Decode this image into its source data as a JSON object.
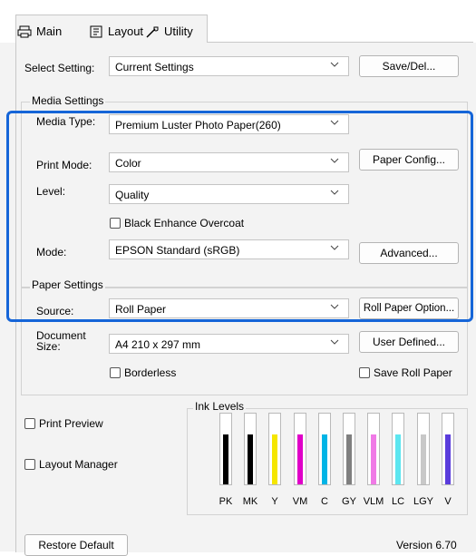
{
  "tabs": [
    {
      "label": "Main",
      "icon": "printer-icon"
    },
    {
      "label": "Layout",
      "icon": "layout-icon"
    },
    {
      "label": "Utility",
      "icon": "wrench-icon"
    }
  ],
  "select_setting": {
    "label": "Select Setting:",
    "value": "Current Settings",
    "button": "Save/Del..."
  },
  "media_settings": {
    "title": "Media Settings",
    "media_type": {
      "label": "Media Type:",
      "value": "Premium Luster Photo Paper(260)"
    },
    "print_mode": {
      "label": "Print Mode:",
      "value": "Color",
      "button": "Paper Config..."
    },
    "level": {
      "label": "Level:",
      "value": "Quality"
    },
    "black_enhance": {
      "label": "Black Enhance Overcoat",
      "checked": false
    },
    "mode": {
      "label": "Mode:",
      "value": "EPSON Standard (sRGB)",
      "button": "Advanced..."
    }
  },
  "paper_settings": {
    "title": "Paper Settings",
    "source": {
      "label": "Source:",
      "value": "Roll Paper",
      "button": "Roll Paper Option..."
    },
    "document_size": {
      "label_line1": "Document",
      "label_line2": "Size:",
      "value": "A4 210 x 297 mm",
      "button": "User Defined..."
    },
    "borderless": {
      "label": "Borderless",
      "checked": false
    },
    "save_roll_paper": {
      "label": "Save Roll Paper",
      "checked": false
    }
  },
  "print_preview": {
    "label": "Print Preview",
    "checked": false
  },
  "layout_manager": {
    "label": "Layout Manager",
    "checked": false
  },
  "ink_levels": {
    "title": "Ink Levels",
    "inks": [
      {
        "name": "PK",
        "color": "#000000",
        "level": 0.7
      },
      {
        "name": "MK",
        "color": "#000000",
        "level": 0.7
      },
      {
        "name": "Y",
        "color": "#f5e600",
        "level": 0.7
      },
      {
        "name": "VM",
        "color": "#e000c8",
        "level": 0.7
      },
      {
        "name": "C",
        "color": "#00b4e6",
        "level": 0.7
      },
      {
        "name": "GY",
        "color": "#7f7f7f",
        "level": 0.7
      },
      {
        "name": "VLM",
        "color": "#f07ae6",
        "level": 0.7
      },
      {
        "name": "LC",
        "color": "#5ce6f0",
        "level": 0.7
      },
      {
        "name": "LGY",
        "color": "#c8c8c8",
        "level": 0.7
      },
      {
        "name": "V",
        "color": "#5a3cdc",
        "level": 0.7
      }
    ]
  },
  "footer": {
    "restore_default": "Restore Default",
    "version": "Version 6.70"
  },
  "accent_color": "#1565d8"
}
